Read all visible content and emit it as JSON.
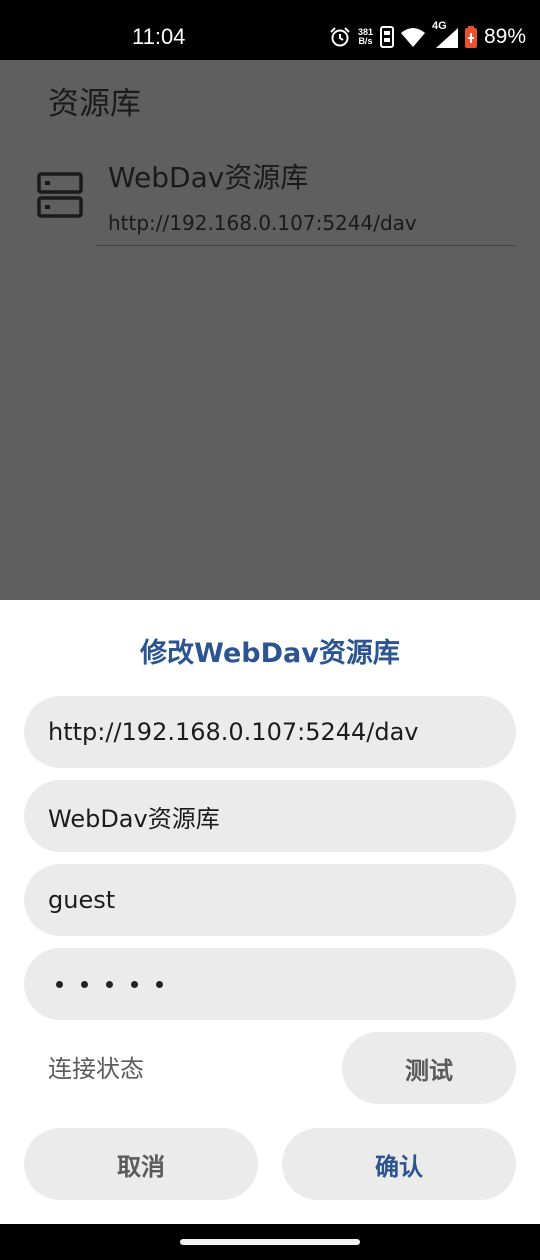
{
  "status_bar": {
    "time": "11:04",
    "net_speed_value": "381",
    "net_speed_unit": "B/s",
    "network_type": "4G",
    "battery": "89%",
    "icons": [
      "alarm-icon",
      "sim-icon",
      "wifi-icon",
      "cell-signal-icon",
      "battery-icon"
    ]
  },
  "app": {
    "title": "资源库",
    "library_items": [
      {
        "name": "WebDav资源库",
        "url": "http://192.168.0.107:5244/dav",
        "icon": "server-icon"
      }
    ]
  },
  "dialog": {
    "title": "修改WebDav资源库",
    "url_value": "http://192.168.0.107:5244/dav",
    "name_value": "WebDav资源库",
    "username_value": "guest",
    "password_length": 5,
    "connection_status_label": "连接状态",
    "test_button": "测试",
    "cancel_button": "取消",
    "confirm_button": "确认"
  },
  "colors": {
    "accent": "#2c5490",
    "scrim": "#5f5f5f",
    "field_background": "#ebebeb"
  }
}
